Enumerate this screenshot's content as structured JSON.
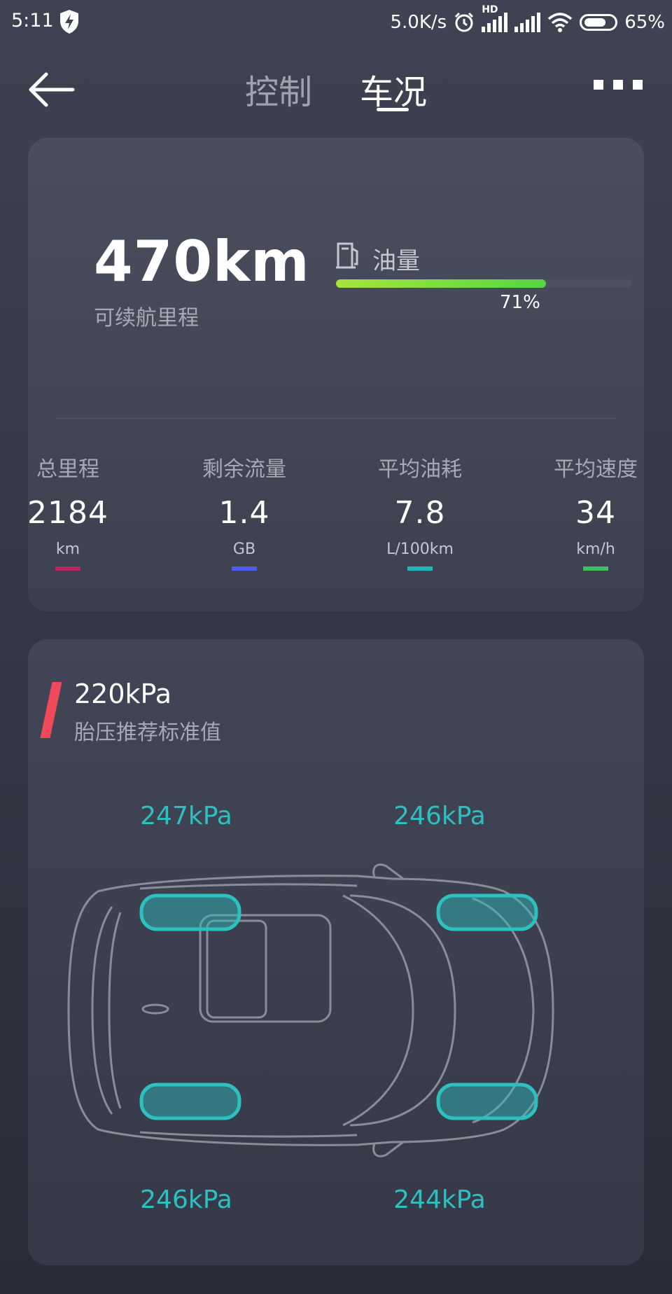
{
  "status_bar": {
    "time": "5:11",
    "net_speed": "5.0K/s",
    "hd_label": "HD",
    "battery": "65%"
  },
  "header": {
    "tabs": [
      {
        "label": "控制",
        "active": false
      },
      {
        "label": "车况",
        "active": true
      }
    ]
  },
  "summary": {
    "range_value": "470km",
    "range_label": "可续航里程",
    "fuel_label": "油量",
    "fuel_percent_text": "71%",
    "fuel_level": 0.71,
    "stats": [
      {
        "label": "总里程",
        "value": "2184",
        "unit": "km",
        "color": "#b8285f"
      },
      {
        "label": "剩余流量",
        "value": "1.4",
        "unit": "GB",
        "color": "#4b5cf2"
      },
      {
        "label": "平均油耗",
        "value": "7.8",
        "unit": "L/100km",
        "color": "#1fb7b9"
      },
      {
        "label": "平均速度",
        "value": "34",
        "unit": "km/h",
        "color": "#3fbf5f"
      }
    ]
  },
  "tire_pressure": {
    "standard_value": "220kPa",
    "standard_label": "胎压推荐标准值",
    "front_left": "247kPa",
    "front_right": "246kPa",
    "rear_left": "246kPa",
    "rear_right": "244kPa"
  },
  "colors": {
    "accent_teal": "#2dc0c0",
    "standard_mark": "#ee4a5b"
  }
}
